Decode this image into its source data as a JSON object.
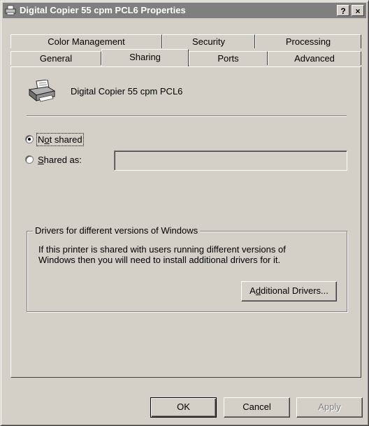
{
  "window": {
    "title": "Digital Copier 55 cpm PCL6 Properties",
    "help_button": "?",
    "close_button": "×"
  },
  "tabs": {
    "row_back": [
      "Color Management",
      "Security",
      "Processing"
    ],
    "row_front": [
      "General",
      "Sharing",
      "Ports",
      "Advanced"
    ],
    "active": "Sharing"
  },
  "sharing": {
    "printer_name": "Digital Copier 55 cpm PCL6",
    "not_shared_label_pre": "N",
    "not_shared_label_mn": "o",
    "not_shared_label_post": "t shared",
    "shared_as_label_mn": "S",
    "shared_as_label_post": "hared as:",
    "share_name_value": "",
    "selected_option": "Not shared"
  },
  "drivers_group": {
    "title": "Drivers for different versions of Windows",
    "line1": "If this printer is shared with users running different versions of",
    "line2": "Windows then you will need to install additional drivers for it.",
    "button_pre": "A",
    "button_mn": "d",
    "button_post": "ditional Drivers..."
  },
  "footer": {
    "ok_label": "OK",
    "cancel_label": "Cancel",
    "apply_label": "Apply"
  },
  "colors": {
    "face": "#d4d0c8",
    "titlebar": "#7f7f7f",
    "disabled_text": "#808080"
  }
}
